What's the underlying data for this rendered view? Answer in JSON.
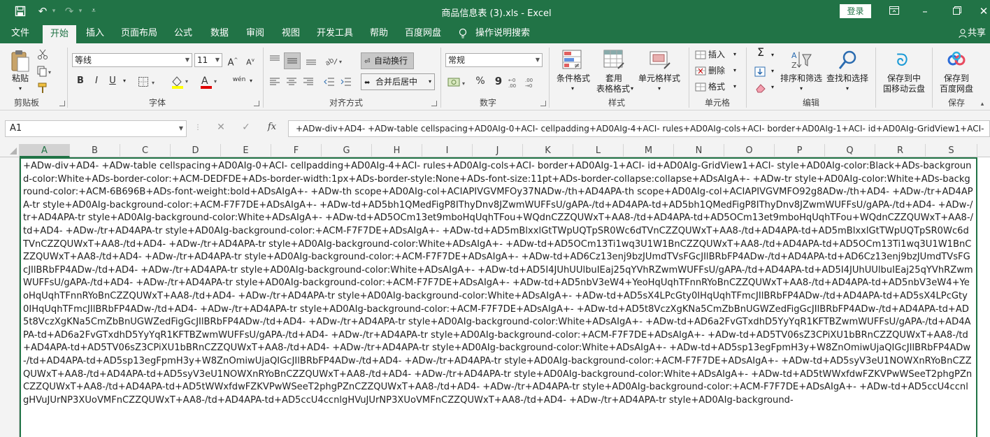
{
  "title_bar": {
    "doc_title": "商品信息表 (3).xls  -  Excel",
    "login_label": "登录",
    "colors": {
      "accent": "#217346"
    }
  },
  "tabs": [
    "文件",
    "开始",
    "插入",
    "页面布局",
    "公式",
    "数据",
    "审阅",
    "视图",
    "开发工具",
    "帮助",
    "百度网盘",
    "操作说明搜索",
    "共享"
  ],
  "ribbon": {
    "clipboard": {
      "paste": "粘贴",
      "label": "剪贴板"
    },
    "font": {
      "family": "等线",
      "size": "11",
      "label": "字体",
      "bold": "B",
      "italic": "I",
      "underline": "U",
      "phonetic": "wén"
    },
    "alignment": {
      "wrap": "自动换行",
      "merge": "合并后居中",
      "label": "对齐方式"
    },
    "number": {
      "format": "常规",
      "percent": "%",
      "comma": "9",
      "label": "数字"
    },
    "styles": {
      "conditional": "条件格式",
      "table1": "套用",
      "table2": "表格格式",
      "cell_styles": "单元格样式",
      "label": "样式"
    },
    "cells": {
      "insert": "插入",
      "delete": "删除",
      "format": "格式",
      "label": "单元格"
    },
    "editing": {
      "sort": "排序和筛选",
      "find": "查找和选择",
      "label": "编辑"
    },
    "cloud": {
      "mobile1": "保存到中",
      "mobile2": "国移动云盘",
      "baidu1": "保存到",
      "baidu2": "百度网盘",
      "label": "保存"
    }
  },
  "formula_bar": {
    "name_box": "A1",
    "fx": "fx",
    "content": "+ADw-div+AD4- +ADw-table cellspacing+AD0AIg-0+ACI- cellpadding+AD0AIg-4+ACI- rules+AD0AIg-cols+ACI- border+AD0AIg-1+ACI- id+AD0AIg-GridView1+ACI-"
  },
  "columns": [
    "A",
    "B",
    "C",
    "D",
    "E",
    "F",
    "G",
    "H",
    "I",
    "J",
    "K",
    "L",
    "M",
    "N",
    "O",
    "P",
    "Q",
    "R",
    "S"
  ],
  "cell_a1": "+ADw-div+AD4- +ADw-table cellspacing+AD0AIg-0+ACI- cellpadding+AD0AIg-4+ACI- rules+AD0AIg-cols+ACI- border+AD0AIg-1+ACI- id+AD0AIg-GridView1+ACI- style+AD0AIg-color:Black+ADs-background-color:White+ADs-border-color:+ACM-DEDFDE+ADs-border-width:1px+ADs-border-style:None+ADs-font-size:11pt+ADs-border-collapse:collapse+ADsAIgA+- +ADw-tr style+AD0AIg-color:White+ADs-background-color:+ACM-6B696B+ADs-font-weight:bold+ADsAIgA+- +ADw-th scope+AD0AIg-col+ACIAPIVGVMFOy37NADw-/th+AD4APA-th scope+AD0AIg-col+ACIAPIVGVMFO92g8ADw-/th+AD4- +ADw-/tr+AD4APA-tr style+AD0AIg-background-color:+ACM-F7F7DE+ADsAIgA+- +ADw-td+AD5bh1QMedFigP8IThyDnv8JZwmWUFFsU/gAPA-/td+AD4APA-td+AD5bh1QMedFigP8IThyDnv8JZwmWUFFsU/gAPA-/td+AD4- +ADw-/tr+AD4APA-tr style+AD0AIg-background-color:White+ADsAIgA+- +ADw-td+AD5OCm13et9mboHqUqhTFou+WQdnCZZQUWxT+AA8-/td+AD4APA-td+AD5OCm13et9mboHqUqhTFou+WQdnCZZQUWxT+AA8-/td+AD4- +ADw-/tr+AD4APA-tr style+AD0AIg-background-color:+ACM-F7F7DE+ADsAIgA+- +ADw-td+AD5mBlxxlGtTWpUQTpSR0Wc6dTVnCZZQUWxT+AA8-/td+AD4APA-td+AD5mBlxxlGtTWpUQTpSR0Wc6dTVnCZZQUWxT+AA8-/td+AD4- +ADw-/tr+AD4APA-tr style+AD0AIg-background-color:White+ADsAIgA+- +ADw-td+AD5OCm13Ti1wq3U1W1BnCZZQUWxT+AA8-/td+AD4APA-td+AD5OCm13Ti1wq3U1W1BnCZZQUWxT+AA8-/td+AD4- +ADw-/tr+AD4APA-tr style+AD0AIg-background-color:+ACM-F7F7DE+ADsAIgA+- +ADw-td+AD6Cz13enj9bzJUmdTVsFGcJIlBRbFP4ADw-/td+AD4APA-td+AD6Cz13enj9bzJUmdTVsFGcJIlBRbFP4ADw-/td+AD4- +ADw-/tr+AD4APA-tr style+AD0AIg-background-color:White+ADsAIgA+- +ADw-td+AD5I4JUhUUlbuIEaj25qYVhRZwmWUFFsU/gAPA-/td+AD4APA-td+AD5I4JUhUUlbuIEaj25qYVhRZwmWUFFsU/gAPA-/td+AD4- +ADw-/tr+AD4APA-tr style+AD0AIg-background-color:+ACM-F7F7DE+ADsAIgA+- +ADw-td+AD5nbV3eW4+YeoHqUqhTFnnRYoBnCZZQUWxT+AA8-/td+AD4APA-td+AD5nbV3eW4+YeoHqUqhTFnnRYoBnCZZQUWxT+AA8-/td+AD4- +ADw-/tr+AD4APA-tr style+AD0AIg-background-color:White+ADsAIgA+- +ADw-td+AD5sX4LPcGty0IHqUqhTFmcJIlBRbFP4ADw-/td+AD4APA-td+AD5sX4LPcGty0IHqUqhTFmcJIlBRbFP4ADw-/td+AD4- +ADw-/tr+AD4APA-tr style+AD0AIg-background-color:+ACM-F7F7DE+ADsAIgA+- +ADw-td+AD5t8VczXgKNa5CmZbBnUGWZedFigGcJIlBRbFP4ADw-/td+AD4APA-td+AD5t8VczXgKNa5CmZbBnUGWZedFigGcJIlBRbFP4ADw-/td+AD4- +ADw-/tr+AD4APA-tr style+AD0AIg-background-color:White+ADsAIgA+- +ADw-td+AD6a2FvGTxdhD5YyYqR1KFTBZwmWUFFsU/gAPA-/td+AD4APA-td+AD6a2FvGTxdhD5YyYqR1KFTBZwmWUFFsU/gAPA-/td+AD4- +ADw-/tr+AD4APA-tr style+AD0AIg-background-color:+ACM-F7F7DE+ADsAIgA+- +ADw-td+AD5TV06sZ3CPiXU1bBRnCZZQUWxT+AA8-/td+AD4APA-td+AD5TV06sZ3CPiXU1bBRnCZZQUWxT+AA8-/td+AD4- +ADw-/tr+AD4APA-tr style+AD0AIg-background-color:White+ADsAIgA+- +ADw-td+AD5sp13egFpmH3y+W8ZnOmiwUjaQIGcJIlBRbFP4ADw-/td+AD4APA-td+AD5sp13egFpmH3y+W8ZnOmiwUjaQIGcJIlBRbFP4ADw-/td+AD4- +ADw-/tr+AD4APA-tr style+AD0AIg-background-color:+ACM-F7F7DE+ADsAIgA+- +ADw-td+AD5syV3eU1NOWXnRYoBnCZZQUWxT+AA8-/td+AD4APA-td+AD5syV3eU1NOWXnRYoBnCZZQUWxT+AA8-/td+AD4- +ADw-/tr+AD4APA-tr style+AD0AIg-background-color:White+ADsAIgA+- +ADw-td+AD5tWWxfdwFZKVPwWSeeT2phgPZnCZZQUWxT+AA8-/td+AD4APA-td+AD5tWWxfdwFZKVPwWSeeT2phgPZnCZZQUWxT+AA8-/td+AD4- +ADw-/tr+AD4APA-tr style+AD0AIg-background-color:+ACM-F7F7DE+ADsAIgA+- +ADw-td+AD5ccU4ccnlgHVuJUrNP3XUoVMFnCZZQUWxT+AA8-/td+AD4APA-td+AD5ccU4ccnlgHVuJUrNP3XUoVMFnCZZQUWxT+AA8-/td+AD4- +ADw-/tr+AD4APA-tr style+AD0AIg-background-"
}
